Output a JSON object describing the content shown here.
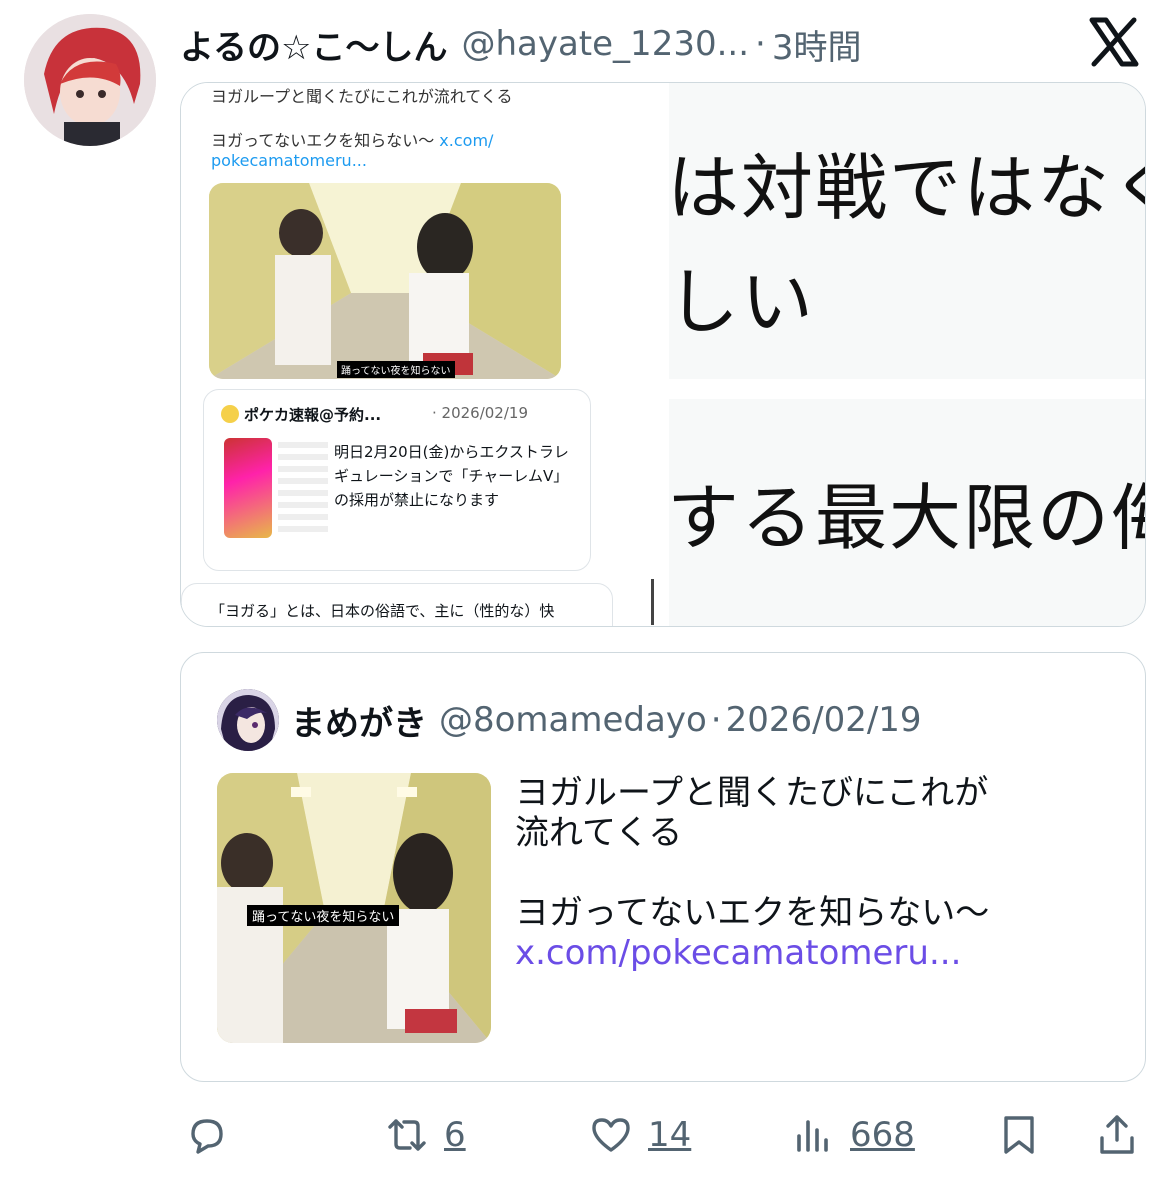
{
  "tweet": {
    "display_name": "よるの☆こ〜しん",
    "handle": "@hayate_1230...",
    "separator": "·",
    "time": "3時間",
    "platform_icon": "x-logo-icon"
  },
  "media_left": {
    "line1": "ヨガループと聞くたびにこれが流れてくる",
    "line2_text": "ヨガってないエクを知らない〜",
    "line2_link": "x.com/",
    "line3_link": "pokecamatomeru...",
    "image_caption": "踊ってない夜を知らない",
    "card_author": "ポケカ速報@予約...",
    "card_date": "· 2026/02/19",
    "card_text": "明日2月20日(金)からエクストラレギュレーションで「チャーレムV」の採用が禁止になります",
    "bottom_text": "「ヨガる」とは、日本の俗語で、主に（性的な）快"
  },
  "media_right": {
    "line1": "は対戦ではなく",
    "line2": "しい",
    "line3": "する最大限の侮"
  },
  "quote": {
    "display_name": "まめがき",
    "handle": "@8omamedayo",
    "separator": "·",
    "date": "2026/02/19",
    "image_caption": "踊ってない夜を知らない",
    "text_line1": "ヨガループと聞くたびにこれが",
    "text_line2": "流れてくる",
    "text_line3": "ヨガってないエクを知らない〜",
    "link": "x.com/pokecamatomeru..."
  },
  "actions": {
    "reply_icon": "reply-icon",
    "retweet_icon": "retweet-icon",
    "retweet_count": "6",
    "like_icon": "heart-icon",
    "like_count": "14",
    "views_icon": "views-icon",
    "views_count": "668",
    "bookmark_icon": "bookmark-icon",
    "share_icon": "share-icon"
  },
  "colors": {
    "text": "#0f1419",
    "secondary": "#536471",
    "border": "#cfd9de",
    "link": "#6b4de6"
  }
}
